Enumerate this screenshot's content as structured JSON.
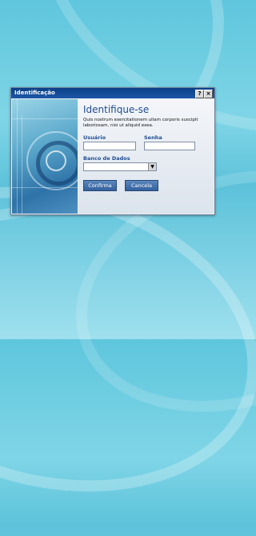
{
  "dialog": {
    "title": "Identificação",
    "help_label": "?",
    "close_label": "×",
    "heading": "Identifique-se",
    "description": "Quis nostrum exercitationem ullam corporis suscipit laboriosam, nisi ut aliquid exea.",
    "user_label": "Usuário",
    "user_value": "",
    "password_label": "Senha",
    "password_value": "",
    "database_label": "Banco de Dados",
    "database_value": "",
    "confirm_label": "Confirma",
    "cancel_label": "Cancela"
  },
  "colors": {
    "accent": "#1f4d92",
    "titlebar": "#0b3f87",
    "background": "#5fc6dd"
  }
}
